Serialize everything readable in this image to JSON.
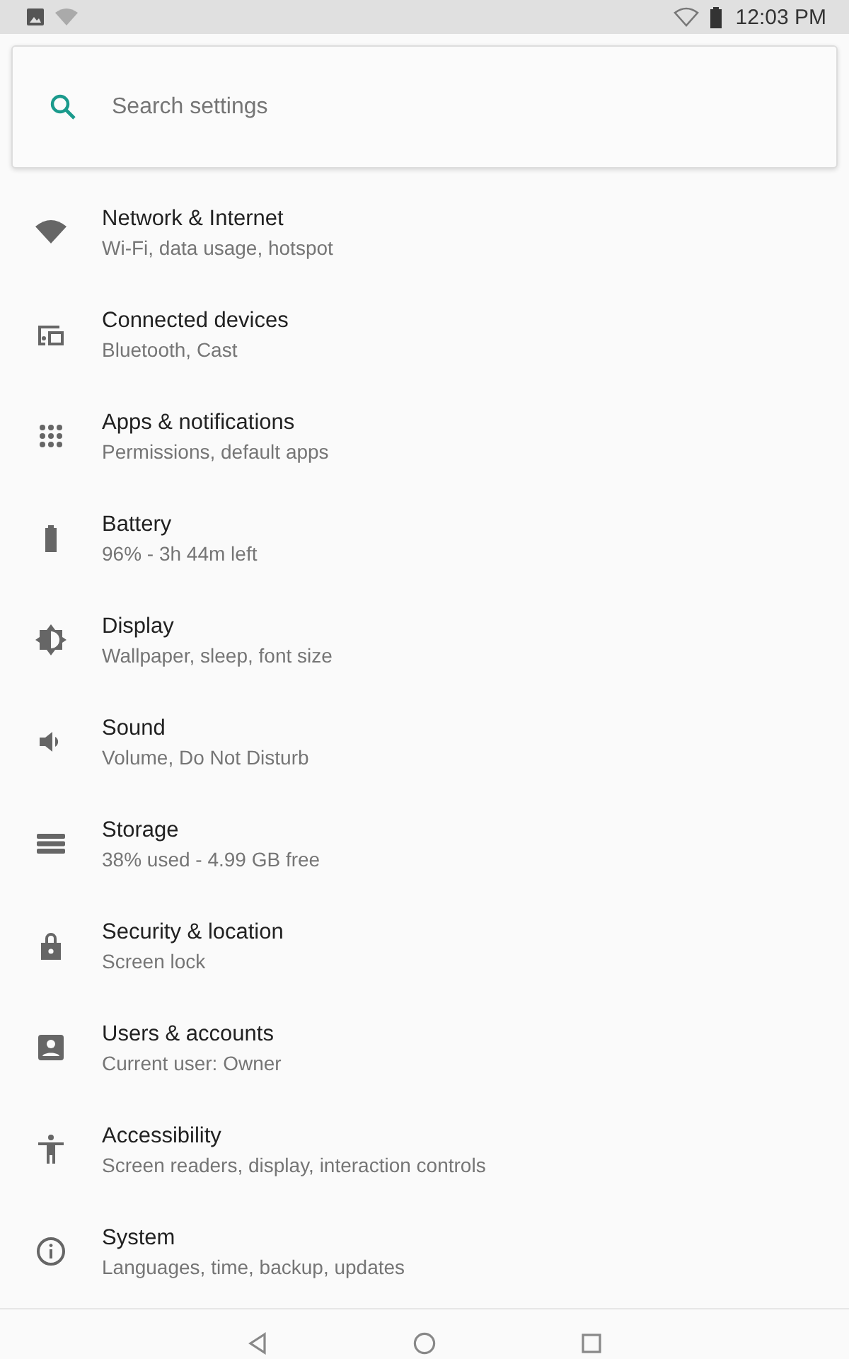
{
  "status_bar": {
    "time": "12:03 PM"
  },
  "search": {
    "placeholder": "Search settings"
  },
  "items": [
    {
      "title": "Network & Internet",
      "summary": "Wi-Fi, data usage, hotspot"
    },
    {
      "title": "Connected devices",
      "summary": "Bluetooth, Cast"
    },
    {
      "title": "Apps & notifications",
      "summary": "Permissions, default apps"
    },
    {
      "title": "Battery",
      "summary": "96% - 3h 44m left"
    },
    {
      "title": "Display",
      "summary": "Wallpaper, sleep, font size"
    },
    {
      "title": "Sound",
      "summary": "Volume, Do Not Disturb"
    },
    {
      "title": "Storage",
      "summary": "38% used - 4.99 GB free"
    },
    {
      "title": "Security & location",
      "summary": "Screen lock"
    },
    {
      "title": "Users & accounts",
      "summary": "Current user: Owner"
    },
    {
      "title": "Accessibility",
      "summary": "Screen readers, display, interaction controls"
    },
    {
      "title": "System",
      "summary": "Languages, time, backup, updates"
    }
  ]
}
